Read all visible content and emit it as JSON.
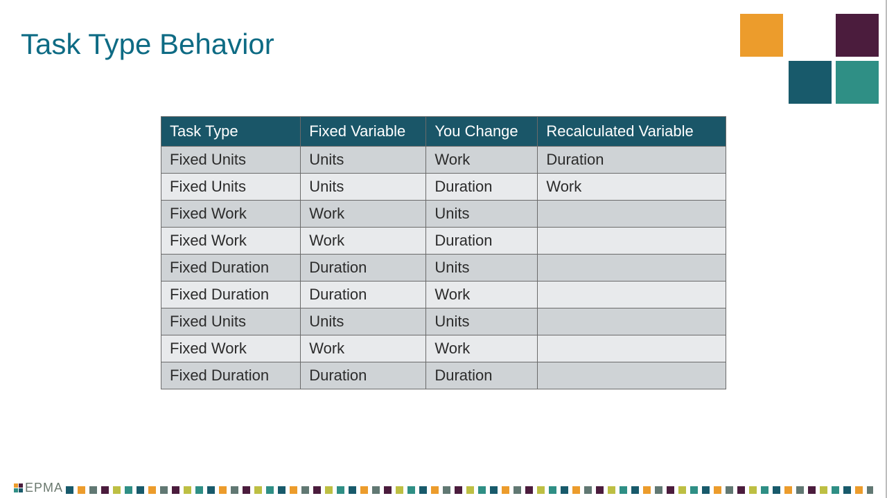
{
  "title": "Task Type Behavior",
  "logo_text": "EPMA",
  "colors": {
    "title": "#0e6b84",
    "header_bg": "#1a5668",
    "row_dark": "#cfd3d6",
    "row_light": "#e8eaec",
    "squares": {
      "orange": "#ec9c2c",
      "purple": "#4b1c3d",
      "teal_dark": "#185a6b",
      "teal_light": "#2f8f85"
    }
  },
  "table": {
    "headers": [
      "Task Type",
      "Fixed Variable",
      "You Change",
      "Recalculated Variable"
    ],
    "rows": [
      [
        "Fixed Units",
        "Units",
        "Work",
        "Duration"
      ],
      [
        "Fixed Units",
        "Units",
        "Duration",
        "Work"
      ],
      [
        "Fixed Work",
        "Work",
        "Units",
        ""
      ],
      [
        "Fixed Work",
        "Work",
        "Duration",
        ""
      ],
      [
        "Fixed Duration",
        "Duration",
        "Units",
        ""
      ],
      [
        "Fixed Duration",
        "Duration",
        "Work",
        ""
      ],
      [
        "Fixed Units",
        "Units",
        "Units",
        ""
      ],
      [
        "Fixed Work",
        "Work",
        "Work",
        ""
      ],
      [
        "Fixed Duration",
        "Duration",
        "Duration",
        ""
      ]
    ]
  },
  "chart_data": {
    "type": "table",
    "title": "Task Type Behavior",
    "columns": [
      "Task Type",
      "Fixed Variable",
      "You Change",
      "Recalculated Variable"
    ],
    "rows": [
      [
        "Fixed Units",
        "Units",
        "Work",
        "Duration"
      ],
      [
        "Fixed Units",
        "Units",
        "Duration",
        "Work"
      ],
      [
        "Fixed Work",
        "Work",
        "Units",
        ""
      ],
      [
        "Fixed Work",
        "Work",
        "Duration",
        ""
      ],
      [
        "Fixed Duration",
        "Duration",
        "Units",
        ""
      ],
      [
        "Fixed Duration",
        "Duration",
        "Work",
        ""
      ],
      [
        "Fixed Units",
        "Units",
        "Units",
        ""
      ],
      [
        "Fixed Work",
        "Work",
        "Work",
        ""
      ],
      [
        "Fixed Duration",
        "Duration",
        "Duration",
        ""
      ]
    ]
  },
  "dotbar_color_sequence": [
    "col-a",
    "col-b",
    "col-c",
    "col-d",
    "col-e",
    "col-f"
  ]
}
